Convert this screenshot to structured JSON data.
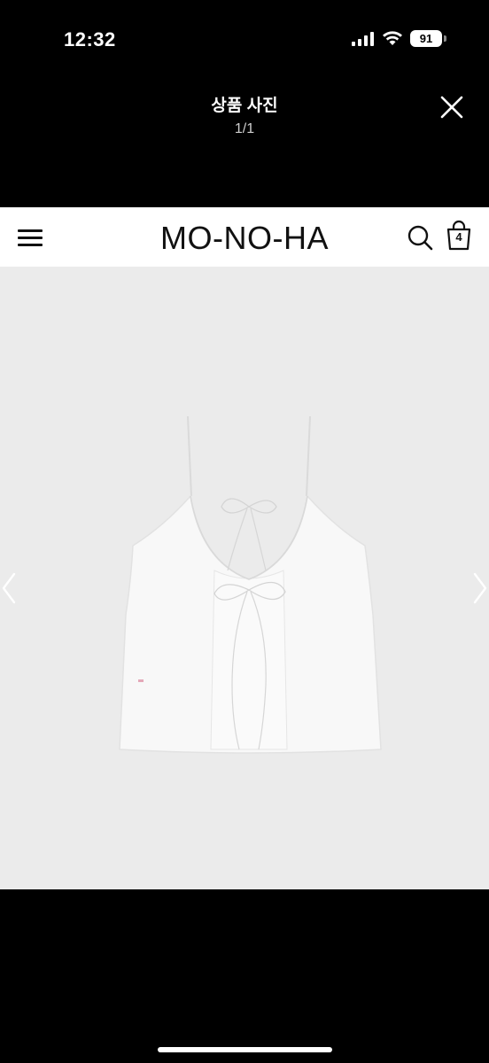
{
  "status_bar": {
    "time": "12:32",
    "battery": "91",
    "icons": [
      "signal-icon",
      "wifi-icon",
      "battery-icon"
    ]
  },
  "viewer": {
    "title": "상품 사진",
    "counter": "1/1",
    "close_icon": "close-icon"
  },
  "photo": {
    "brand": "MO-NO-HA",
    "cart_count": "4",
    "icons": [
      "menu-icon",
      "search-icon",
      "shopping-bag-icon",
      "chevron-left-icon",
      "chevron-right-icon"
    ],
    "colors": {
      "background": "#ebebeb",
      "header": "#ffffff",
      "garment": "#f8f8f8"
    }
  }
}
